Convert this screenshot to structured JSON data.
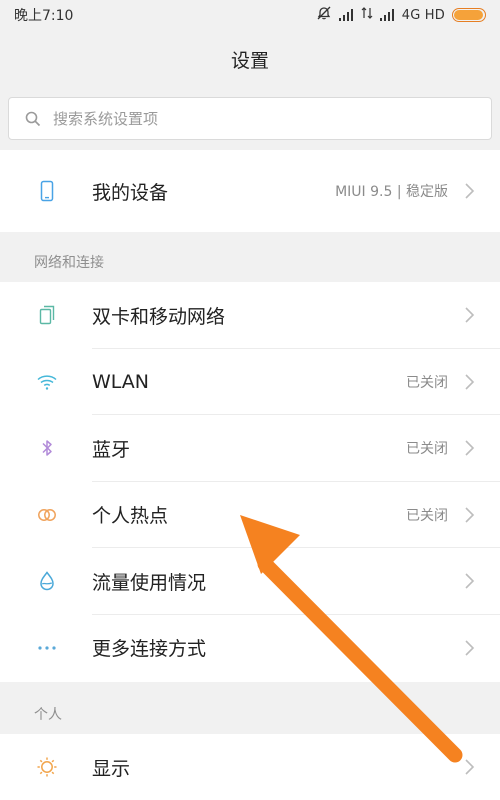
{
  "status_bar": {
    "time": "晚上7:10",
    "network_label": "4G HD",
    "battery_level": 0.95
  },
  "header": {
    "title": "设置"
  },
  "search": {
    "placeholder": "搜索系统设置项"
  },
  "device_section": {
    "item": {
      "icon": "phone-icon",
      "label": "我的设备",
      "value": "MIUI 9.5 | 稳定版"
    }
  },
  "network_section": {
    "title": "网络和连接",
    "items": [
      {
        "icon": "sim-card-icon",
        "label": "双卡和移动网络",
        "value": ""
      },
      {
        "icon": "wifi-icon",
        "label": "WLAN",
        "value": "已关闭"
      },
      {
        "icon": "bluetooth-icon",
        "label": "蓝牙",
        "value": "已关闭"
      },
      {
        "icon": "hotspot-icon",
        "label": "个人热点",
        "value": "已关闭"
      },
      {
        "icon": "data-usage-icon",
        "label": "流量使用情况",
        "value": ""
      },
      {
        "icon": "more-connections-icon",
        "label": "更多连接方式",
        "value": ""
      }
    ]
  },
  "personal_section": {
    "title": "个人",
    "items": [
      {
        "icon": "display-icon",
        "label": "显示",
        "value": ""
      }
    ]
  },
  "colors": {
    "accent_orange": "#f58220",
    "device_icon": "#49a3e6",
    "sim_icon": "#5bb8a5",
    "wifi_icon": "#46b8d9",
    "bluetooth_icon": "#b18ad8",
    "hotspot_icon": "#f0a35c",
    "data_usage_icon": "#4ba9d9",
    "more_icon": "#5aa9d8",
    "display_icon": "#f2a54c"
  }
}
